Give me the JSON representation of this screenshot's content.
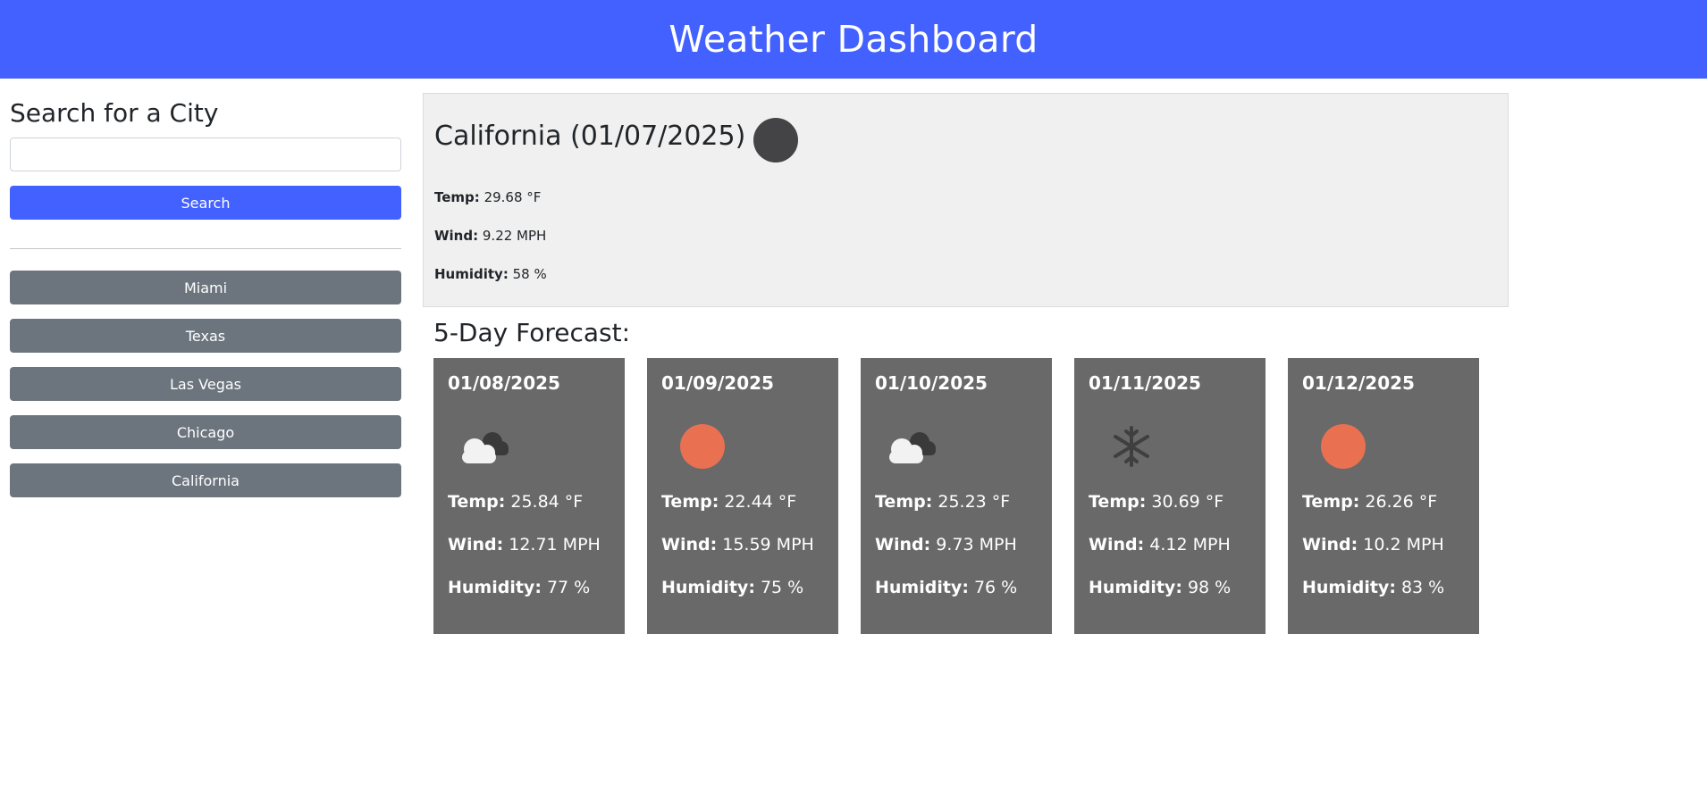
{
  "header": {
    "title": "Weather Dashboard"
  },
  "sidebar": {
    "heading": "Search for a City",
    "search_value": "",
    "search_button": "Search",
    "history": [
      "Miami",
      "Texas",
      "Las Vegas",
      "Chicago",
      "California"
    ]
  },
  "current": {
    "title": "California (01/07/2025)",
    "icon": "moon-icon",
    "temp_label": "Temp:",
    "temp_value": "29.68 °F",
    "wind_label": "Wind:",
    "wind_value": "9.22 MPH",
    "humidity_label": "Humidity:",
    "humidity_value": "58 %"
  },
  "forecast": {
    "title": "5-Day Forecast:",
    "temp_label": "Temp:",
    "wind_label": "Wind:",
    "humidity_label": "Humidity:",
    "days": [
      {
        "date": "01/08/2025",
        "icon": "cloud-icon",
        "temp": "25.84 °F",
        "wind": "12.71 MPH",
        "humidity": "77 %"
      },
      {
        "date": "01/09/2025",
        "icon": "sun-icon",
        "temp": "22.44 °F",
        "wind": "15.59 MPH",
        "humidity": "75 %"
      },
      {
        "date": "01/10/2025",
        "icon": "cloud-icon",
        "temp": "25.23 °F",
        "wind": "9.73 MPH",
        "humidity": "76 %"
      },
      {
        "date": "01/11/2025",
        "icon": "snowflake-icon",
        "temp": "30.69 °F",
        "wind": "4.12 MPH",
        "humidity": "98 %"
      },
      {
        "date": "01/12/2025",
        "icon": "sun-icon",
        "temp": "26.26 °F",
        "wind": "10.2 MPH",
        "humidity": "83 %"
      }
    ]
  },
  "colors": {
    "header": "#4361ff",
    "primary_button": "#4361ff",
    "history_button": "#6c757d",
    "card": "#696969",
    "current_bg": "#f0f0f0",
    "sun": "#e97152",
    "moon": "#444446"
  }
}
